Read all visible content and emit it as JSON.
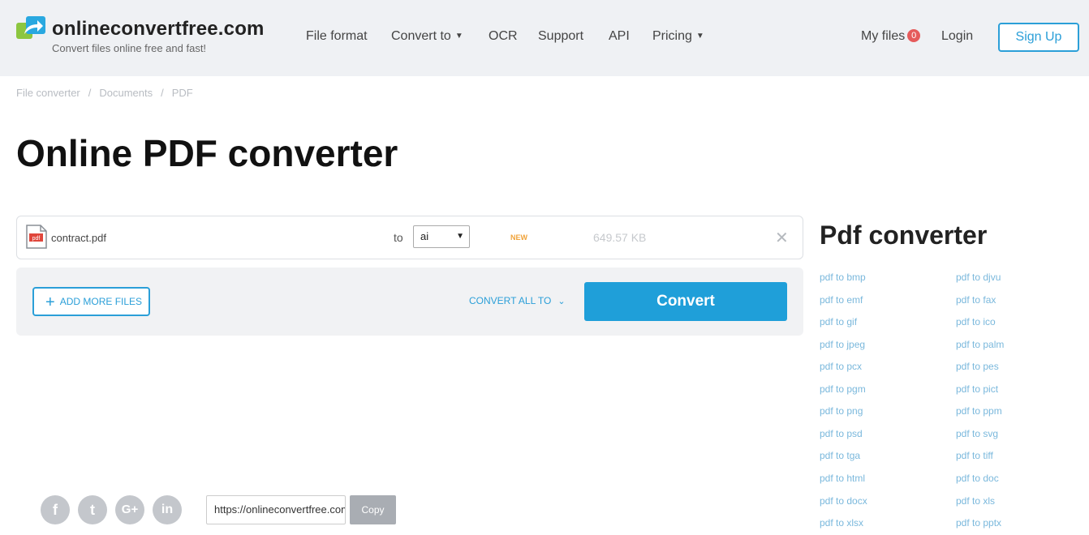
{
  "header": {
    "logo_title": "onlineconvertfree.com",
    "logo_tagline": "Convert files online free and fast!",
    "nav": {
      "file_format": "File format",
      "convert_to": "Convert to",
      "ocr": "OCR",
      "support": "Support",
      "api": "API",
      "pricing": "Pricing"
    },
    "my_files": "My files",
    "my_files_count": "0",
    "login": "Login",
    "signup": "Sign Up"
  },
  "breadcrumb": [
    "File converter",
    "Documents",
    "PDF"
  ],
  "page_title": "Online PDF converter",
  "file": {
    "name": "contract.pdf",
    "icon_label": "pdf",
    "to_label": "to",
    "selected_format": "ai",
    "new_badge": "NEW",
    "size": "649.57 KB"
  },
  "actions": {
    "add_more": "ADD MORE FILES",
    "convert_all": "CONVERT ALL TO",
    "convert": "Convert"
  },
  "sidebar": {
    "title": "Pdf converter",
    "links_left": [
      "pdf to bmp",
      "pdf to emf",
      "pdf to gif",
      "pdf to jpeg",
      "pdf to pcx",
      "pdf to pgm",
      "pdf to png",
      "pdf to psd",
      "pdf to tga",
      "pdf to html",
      "pdf to docx",
      "pdf to xlsx"
    ],
    "links_right": [
      "pdf to djvu",
      "pdf to fax",
      "pdf to ico",
      "pdf to palm",
      "pdf to pes",
      "pdf to pict",
      "pdf to ppm",
      "pdf to svg",
      "pdf to tiff",
      "pdf to doc",
      "pdf to xls",
      "pdf to pptx"
    ]
  },
  "share": {
    "social": [
      "f",
      "t",
      "G+",
      "in"
    ],
    "url": "https://onlineconvertfree.com/",
    "copy": "Copy"
  },
  "colors": {
    "accent": "#1f9fd9",
    "header_bg": "#eff1f4",
    "badge": "#e55b5b",
    "new": "#f0a33a",
    "link": "#7ab8dc"
  }
}
